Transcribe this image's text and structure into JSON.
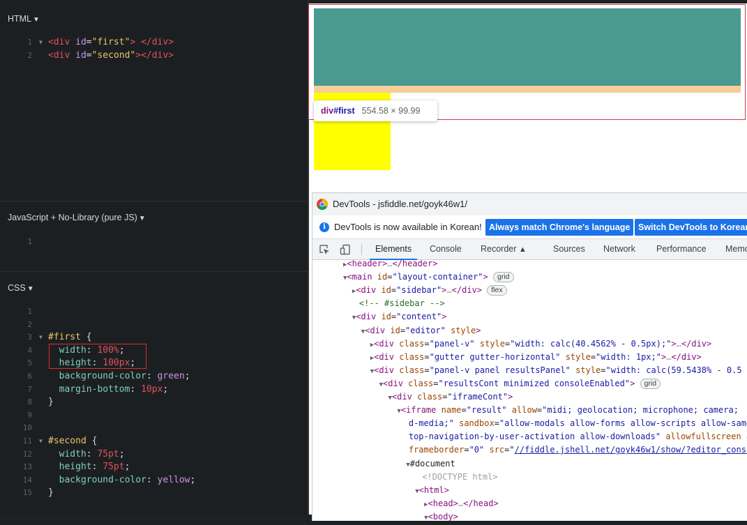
{
  "editor": {
    "html_panel": {
      "title": "HTML",
      "lines": [
        {
          "n": "1",
          "fold": true,
          "parts": [
            [
              "tag",
              "<div"
            ],
            [
              "punc",
              " "
            ],
            [
              "attr",
              "id"
            ],
            [
              "punc",
              "="
            ],
            [
              "str",
              "\"first\""
            ],
            [
              "tag",
              ">"
            ],
            [
              "punc",
              " "
            ],
            [
              "tag",
              "</div>"
            ]
          ]
        },
        {
          "n": "2",
          "fold": false,
          "parts": [
            [
              "tag",
              "<div"
            ],
            [
              "punc",
              " "
            ],
            [
              "attr",
              "id"
            ],
            [
              "punc",
              "="
            ],
            [
              "str",
              "\"second\""
            ],
            [
              "tag",
              ">"
            ],
            [
              "tag",
              "</div>"
            ]
          ]
        }
      ]
    },
    "js_panel": {
      "title": "JavaScript + No-Library (pure JS)",
      "lines": [
        {
          "n": "1",
          "fold": false,
          "parts": []
        }
      ]
    },
    "css_panel": {
      "title": "CSS",
      "lines": [
        {
          "n": "1",
          "fold": false,
          "parts": []
        },
        {
          "n": "2",
          "fold": false,
          "parts": []
        },
        {
          "n": "3",
          "fold": true,
          "parts": [
            [
              "sel",
              "#first"
            ],
            [
              "punc",
              " {"
            ]
          ]
        },
        {
          "n": "4",
          "fold": false,
          "parts": [
            [
              "punc",
              "  "
            ],
            [
              "prop",
              "width"
            ],
            [
              "punc",
              ": "
            ],
            [
              "num",
              "100%"
            ],
            [
              "punc",
              ";"
            ]
          ]
        },
        {
          "n": "5",
          "fold": false,
          "parts": [
            [
              "punc",
              "  "
            ],
            [
              "prop",
              "height"
            ],
            [
              "punc",
              ": "
            ],
            [
              "num",
              "100px"
            ],
            [
              "punc",
              ";"
            ]
          ]
        },
        {
          "n": "6",
          "fold": false,
          "parts": [
            [
              "punc",
              "  "
            ],
            [
              "prop",
              "background-color"
            ],
            [
              "punc",
              ": "
            ],
            [
              "kw",
              "green"
            ],
            [
              "punc",
              ";"
            ]
          ]
        },
        {
          "n": "7",
          "fold": false,
          "parts": [
            [
              "punc",
              "  "
            ],
            [
              "prop",
              "margin-bottom"
            ],
            [
              "punc",
              ": "
            ],
            [
              "num",
              "10px"
            ],
            [
              "punc",
              ";"
            ]
          ]
        },
        {
          "n": "8",
          "fold": false,
          "parts": [
            [
              "punc",
              "}"
            ]
          ]
        },
        {
          "n": "9",
          "fold": false,
          "parts": []
        },
        {
          "n": "10",
          "fold": false,
          "parts": []
        },
        {
          "n": "11",
          "fold": true,
          "parts": [
            [
              "sel",
              "#second"
            ],
            [
              "punc",
              " {"
            ]
          ]
        },
        {
          "n": "12",
          "fold": false,
          "parts": [
            [
              "punc",
              "  "
            ],
            [
              "prop",
              "width"
            ],
            [
              "punc",
              ": "
            ],
            [
              "num",
              "75pt"
            ],
            [
              "punc",
              ";"
            ]
          ]
        },
        {
          "n": "13",
          "fold": false,
          "parts": [
            [
              "punc",
              "  "
            ],
            [
              "prop",
              "height"
            ],
            [
              "punc",
              ": "
            ],
            [
              "num",
              "75pt"
            ],
            [
              "punc",
              ";"
            ]
          ]
        },
        {
          "n": "14",
          "fold": false,
          "parts": [
            [
              "punc",
              "  "
            ],
            [
              "prop",
              "background-color"
            ],
            [
              "punc",
              ": "
            ],
            [
              "kw",
              "yellow"
            ],
            [
              "punc",
              ";"
            ]
          ]
        },
        {
          "n": "15",
          "fold": false,
          "parts": [
            [
              "punc",
              "}"
            ]
          ]
        }
      ]
    }
  },
  "result": {
    "tooltip": {
      "tag": "div",
      "id": "#first",
      "size": "554.58 × 99.99"
    },
    "colors": {
      "first": "#4a9a8f",
      "margin": "#f8cd9a",
      "second": "#ffff00",
      "outline": "#d9334a"
    }
  },
  "devtools": {
    "title": "DevTools - jsfiddle.net/goyk46w1/",
    "info_text": "DevTools is now available in Korean!",
    "btn_match": "Always match Chrome's language",
    "btn_switch": "Switch DevTools to Korean",
    "tabs": [
      "Elements",
      "Console",
      "Recorder",
      "Sources",
      "Network",
      "Performance",
      "Memo"
    ],
    "active_tab": "Elements",
    "dom_lines": [
      {
        "indent": 3,
        "tri": "▶",
        "parts": [
          [
            "dtag",
            "<header>"
          ],
          [
            "dgray",
            "…"
          ],
          [
            "dtag",
            "</header>"
          ]
        ]
      },
      {
        "indent": 3,
        "tri": "▼",
        "parts": [
          [
            "dtag",
            "<main"
          ],
          [
            "d",
            " "
          ],
          [
            "dattr",
            "id"
          ],
          [
            "d",
            "="
          ],
          [
            "dval",
            "\"layout-container\""
          ],
          [
            "dtag",
            ">"
          ]
        ],
        "badge": "grid"
      },
      {
        "indent": 4,
        "tri": "▶",
        "parts": [
          [
            "dtag",
            "<div"
          ],
          [
            "d",
            " "
          ],
          [
            "dattr",
            "id"
          ],
          [
            "d",
            "="
          ],
          [
            "dval",
            "\"sidebar\""
          ],
          [
            "dtag",
            ">"
          ],
          [
            "dgray",
            "…"
          ],
          [
            "dtag",
            "</div>"
          ]
        ],
        "badge": "flex"
      },
      {
        "indent": 4,
        "tri": "",
        "parts": [
          [
            "dcom",
            "<!-- #sidebar -->"
          ]
        ]
      },
      {
        "indent": 4,
        "tri": "▼",
        "parts": [
          [
            "dtag",
            "<div"
          ],
          [
            "d",
            " "
          ],
          [
            "dattr",
            "id"
          ],
          [
            "d",
            "="
          ],
          [
            "dval",
            "\"content\""
          ],
          [
            "dtag",
            ">"
          ]
        ]
      },
      {
        "indent": 5,
        "tri": "▼",
        "parts": [
          [
            "dtag",
            "<div"
          ],
          [
            "d",
            " "
          ],
          [
            "dattr",
            "id"
          ],
          [
            "d",
            "="
          ],
          [
            "dval",
            "\"editor\""
          ],
          [
            "d",
            " "
          ],
          [
            "dattr",
            "style"
          ],
          [
            "dtag",
            ">"
          ]
        ]
      },
      {
        "indent": 6,
        "tri": "▶",
        "parts": [
          [
            "dtag",
            "<div"
          ],
          [
            "d",
            " "
          ],
          [
            "dattr",
            "class"
          ],
          [
            "d",
            "="
          ],
          [
            "dval",
            "\"panel-v\""
          ],
          [
            "d",
            " "
          ],
          [
            "dattr",
            "style"
          ],
          [
            "d",
            "="
          ],
          [
            "dval",
            "\"width: calc(40.4562% - 0.5px);\""
          ],
          [
            "dtag",
            ">"
          ],
          [
            "dgray",
            "…"
          ],
          [
            "dtag",
            "</div>"
          ]
        ]
      },
      {
        "indent": 6,
        "tri": "▶",
        "parts": [
          [
            "dtag",
            "<div"
          ],
          [
            "d",
            " "
          ],
          [
            "dattr",
            "class"
          ],
          [
            "d",
            "="
          ],
          [
            "dval",
            "\"gutter gutter-horizontal\""
          ],
          [
            "d",
            " "
          ],
          [
            "dattr",
            "style"
          ],
          [
            "d",
            "="
          ],
          [
            "dval",
            "\"width: 1px;\""
          ],
          [
            "dtag",
            ">"
          ],
          [
            "dgray",
            "…"
          ],
          [
            "dtag",
            "</div>"
          ]
        ]
      },
      {
        "indent": 6,
        "tri": "▼",
        "parts": [
          [
            "dtag",
            "<div"
          ],
          [
            "d",
            " "
          ],
          [
            "dattr",
            "class"
          ],
          [
            "d",
            "="
          ],
          [
            "dval",
            "\"panel-v panel resultsPanel\""
          ],
          [
            "d",
            " "
          ],
          [
            "dattr",
            "style"
          ],
          [
            "d",
            "="
          ],
          [
            "dval",
            "\"width: calc(59.5438% - 0.5"
          ]
        ]
      },
      {
        "indent": 7,
        "tri": "▼",
        "parts": [
          [
            "dtag",
            "<div"
          ],
          [
            "d",
            " "
          ],
          [
            "dattr",
            "class"
          ],
          [
            "d",
            "="
          ],
          [
            "dval",
            "\"resultsCont minimized consoleEnabled\""
          ],
          [
            "dtag",
            ">"
          ]
        ],
        "badge": "grid"
      },
      {
        "indent": 8,
        "tri": "▼",
        "parts": [
          [
            "dtag",
            "<div"
          ],
          [
            "d",
            " "
          ],
          [
            "dattr",
            "class"
          ],
          [
            "d",
            "="
          ],
          [
            "dval",
            "\"iframeCont\""
          ],
          [
            "dtag",
            ">"
          ]
        ]
      },
      {
        "indent": 9,
        "tri": "▼",
        "parts": [
          [
            "dtag",
            "<iframe"
          ],
          [
            "d",
            " "
          ],
          [
            "dattr",
            "name"
          ],
          [
            "d",
            "="
          ],
          [
            "dval",
            "\"result\""
          ],
          [
            "d",
            " "
          ],
          [
            "dattr",
            "allow"
          ],
          [
            "d",
            "="
          ],
          [
            "dval",
            "\"midi; geolocation; microphone; camera;"
          ]
        ]
      },
      {
        "indent": 9.5,
        "tri": "",
        "parts": [
          [
            "dval",
            "d-media;\""
          ],
          [
            "d",
            " "
          ],
          [
            "dattr",
            "sandbox"
          ],
          [
            "d",
            "="
          ],
          [
            "dval",
            "\"allow-modals allow-forms allow-scripts allow-same-"
          ]
        ]
      },
      {
        "indent": 9.5,
        "tri": "",
        "parts": [
          [
            "dval",
            "top-navigation-by-user-activation allow-downloads\""
          ],
          [
            "d",
            " "
          ],
          [
            "dattr",
            "allowfullscreen"
          ],
          [
            "d",
            " "
          ],
          [
            "dattr",
            "al"
          ]
        ]
      },
      {
        "indent": 9.5,
        "tri": "",
        "parts": [
          [
            "dattr",
            "frameborder"
          ],
          [
            "d",
            "="
          ],
          [
            "dval",
            "\"0\""
          ],
          [
            "d",
            " "
          ],
          [
            "dattr",
            "src"
          ],
          [
            "d",
            "=\""
          ],
          [
            "dlink",
            "//fiddle.jshell.net/goyk46w1/show/?editor_consol"
          ]
        ]
      },
      {
        "indent": 10,
        "tri": "▼",
        "parts": [
          [
            "d",
            "#document"
          ]
        ]
      },
      {
        "indent": 11,
        "tri": "",
        "parts": [
          [
            "dgray",
            "<!DOCTYPE html>"
          ]
        ]
      },
      {
        "indent": 11,
        "tri": "▼",
        "parts": [
          [
            "dtag",
            "<html>"
          ]
        ]
      },
      {
        "indent": 12,
        "tri": "▶",
        "parts": [
          [
            "dtag",
            "<head>"
          ],
          [
            "dgray",
            "…"
          ],
          [
            "dtag",
            "</head>"
          ]
        ]
      },
      {
        "indent": 12,
        "tri": "▼",
        "parts": [
          [
            "dtag",
            "<body>"
          ]
        ]
      }
    ]
  }
}
